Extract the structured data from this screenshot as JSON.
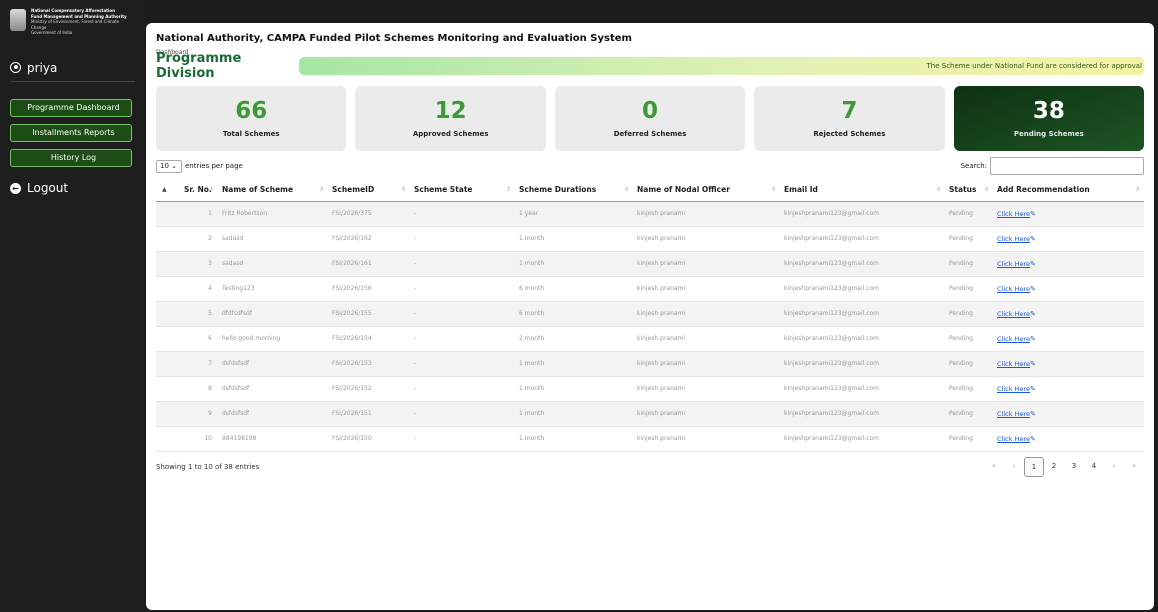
{
  "sidebar": {
    "org_lines": [
      "National Compensatory Afforestation",
      "Fund Management and Planning Authority",
      "Ministry of Environment, Forest and Climate Change",
      "Government of India"
    ],
    "user": "priya",
    "nav": [
      {
        "label": "Programme Dashboard"
      },
      {
        "label": "Installments Reports"
      },
      {
        "label": "History Log"
      }
    ],
    "logout": "Logout"
  },
  "header": {
    "title": "National Authority, CAMPA Funded Pilot Schemes Monitoring and Evaluation System",
    "breadcrumb": "Dashboard",
    "division": "Programme Division",
    "marquee": "The Scheme under National Fund are considered for approval"
  },
  "cards": [
    {
      "value": "66",
      "label": "Total Schemes"
    },
    {
      "value": "12",
      "label": "Approved Schemes"
    },
    {
      "value": "0",
      "label": "Deferred Schemes"
    },
    {
      "value": "7",
      "label": "Rejected Schemes"
    },
    {
      "value": "38",
      "label": "Pending Schemes"
    }
  ],
  "controls": {
    "entries_value": "10",
    "entries_label": "entries per page",
    "search_label": "Search:"
  },
  "table": {
    "headers": [
      "",
      "Sr. No.",
      "Name of Scheme",
      "SchemeID",
      "Scheme State",
      "Scheme Durations",
      "Name of Nodal Officer",
      "Email Id",
      "Status",
      "Add Recommendation"
    ],
    "rows": [
      {
        "sr": "1",
        "name": "Fritz Robertson",
        "id": "FSI/2026/375",
        "state": "-",
        "duration": "1 year",
        "officer": "kinjesh pranami",
        "email": "kinjeshpranami123@gmail.com",
        "status": "Pending",
        "action": "Click Here"
      },
      {
        "sr": "2",
        "name": "sadasd",
        "id": "FSI/2026/162",
        "state": "-",
        "duration": "1 month",
        "officer": "kinjesh pranami",
        "email": "kinjeshpranami123@gmail.com",
        "status": "Pending",
        "action": "Click Here"
      },
      {
        "sr": "3",
        "name": "sadasd",
        "id": "FSI/2026/161",
        "state": "-",
        "duration": "1 month",
        "officer": "kinjesh pranami",
        "email": "kinjeshpranami123@gmail.com",
        "status": "Pending",
        "action": "Click Here"
      },
      {
        "sr": "4",
        "name": "Testing123",
        "id": "FSI/2026/156",
        "state": "-",
        "duration": "6 month",
        "officer": "kinjesh pranami",
        "email": "kinjeshpranami123@gmail.com",
        "status": "Pending",
        "action": "Click Here"
      },
      {
        "sr": "5",
        "name": "dfdfsdfsdf",
        "id": "FSI/2026/155",
        "state": "-",
        "duration": "6 month",
        "officer": "kinjesh pranami",
        "email": "kinjeshpranami123@gmail.com",
        "status": "Pending",
        "action": "Click Here"
      },
      {
        "sr": "6",
        "name": "hello good morning",
        "id": "FSI/2026/154",
        "state": "-",
        "duration": "2 month",
        "officer": "kinjesh pranami",
        "email": "kinjeshpranami123@gmail.com",
        "status": "Pending",
        "action": "Click Here"
      },
      {
        "sr": "7",
        "name": "dsfdsfsdf",
        "id": "FSI/2026/153",
        "state": "-",
        "duration": "1 month",
        "officer": "kinjesh pranami",
        "email": "kinjeshpranami123@gmail.com",
        "status": "Pending",
        "action": "Click Here"
      },
      {
        "sr": "8",
        "name": "dsfdsfsdf",
        "id": "FSI/2026/152",
        "state": "-",
        "duration": "1 month",
        "officer": "kinjesh pranami",
        "email": "kinjeshpranami123@gmail.com",
        "status": "Pending",
        "action": "Click Here"
      },
      {
        "sr": "9",
        "name": "dsfdsfsdf",
        "id": "FSI/2026/151",
        "state": "-",
        "duration": "1 month",
        "officer": "kinjesh pranami",
        "email": "kinjeshpranami123@gmail.com",
        "status": "Pending",
        "action": "Click Here"
      },
      {
        "sr": "10",
        "name": "984198198",
        "id": "FSI/2026/150",
        "state": "-",
        "duration": "1 month",
        "officer": "kinjesh pranami",
        "email": "kinjeshpranami123@gmail.com",
        "status": "Pending",
        "action": "Click Here"
      }
    ]
  },
  "footer": {
    "info": "Showing 1 to 10 of 38 entries",
    "pager": {
      "first": "«",
      "prev": "‹",
      "pages": [
        "1",
        "2",
        "3",
        "4"
      ],
      "next": "›",
      "last": "»"
    }
  },
  "colors": {
    "accent_green": "#3c9a35",
    "nav_green": "#1b4d15",
    "link_blue": "#1a56db"
  }
}
